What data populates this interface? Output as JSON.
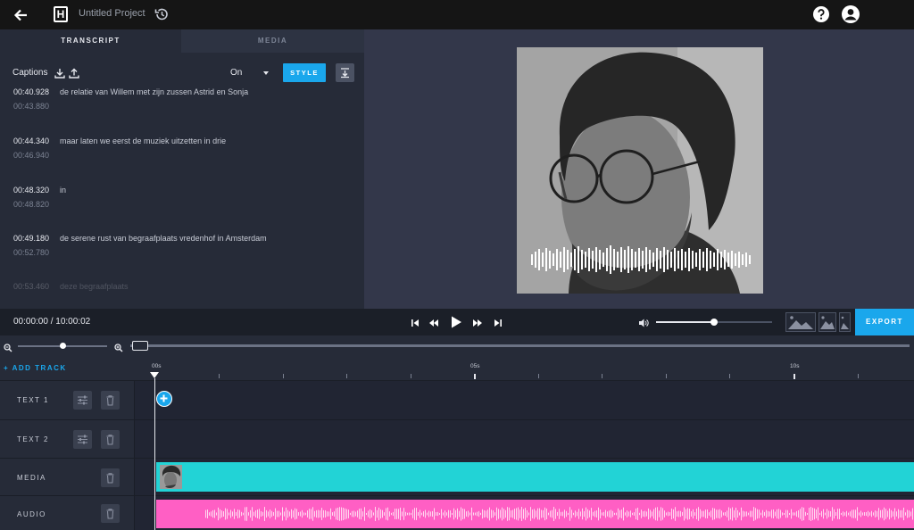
{
  "topbar": {
    "project_title": "Untitled Project",
    "logo_letter": "H"
  },
  "left_panel": {
    "tabs": [
      {
        "label": "TRANSCRIPT",
        "active": true
      },
      {
        "label": "MEDIA",
        "active": false
      }
    ],
    "captions_label": "Captions",
    "captions_select_value": "On",
    "style_button_label": "STYLE",
    "captions": [
      {
        "start": "00:40.928",
        "end": "00:43.880",
        "text": "de relatie van Willem met zijn zussen Astrid en Sonja"
      },
      {
        "start": "00:44.340",
        "end": "00:46.940",
        "text": "maar laten we eerst de muziek uitzetten in drie"
      },
      {
        "start": "00:48.320",
        "end": "00:48.820",
        "text": "in"
      },
      {
        "start": "00:49.180",
        "end": "00:52.780",
        "text": "de serene rust van begraafplaats vredenhof in Amsterdam"
      },
      {
        "start": "00:53.460",
        "end": "",
        "text": "deze begraafplaats"
      }
    ]
  },
  "controls": {
    "timecode": "00:00:00 / 10:00:02",
    "volume_level": 0.5,
    "export_label": "EXPORT"
  },
  "zoom": {
    "level": 0.5
  },
  "timeline": {
    "add_track_label": "+ ADD TRACK",
    "ruler_labels": [
      "00s",
      "05s",
      "10s"
    ],
    "tracks": [
      {
        "label": "TEXT 1"
      },
      {
        "label": "TEXT 2"
      },
      {
        "label": "MEDIA"
      },
      {
        "label": "AUDIO"
      }
    ]
  },
  "colors": {
    "accent": "#1aa7ec",
    "media_clip": "#22d3d6",
    "audio_clip": "#ff5fc4"
  }
}
